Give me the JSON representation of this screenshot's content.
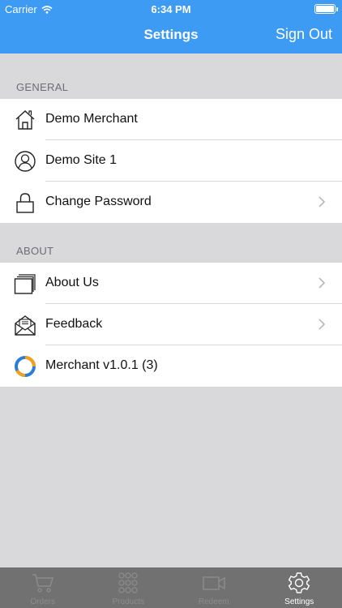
{
  "status_bar": {
    "carrier": "Carrier",
    "time": "6:34 PM"
  },
  "nav": {
    "title": "Settings",
    "right_button": "Sign Out"
  },
  "sections": {
    "general": {
      "label": "GENERAL",
      "items": [
        {
          "label": "Demo Merchant",
          "icon": "home-icon"
        },
        {
          "label": "Demo Site 1",
          "icon": "user-icon"
        },
        {
          "label": "Change Password",
          "icon": "lock-icon"
        }
      ]
    },
    "about": {
      "label": "ABOUT",
      "items": [
        {
          "label": "About Us",
          "icon": "stack-icon"
        },
        {
          "label": "Feedback",
          "icon": "envelope-icon"
        },
        {
          "label": "Merchant v1.0.1 (3)",
          "icon": "app-logo-icon"
        }
      ]
    }
  },
  "tabbar": {
    "tabs": [
      {
        "label": "Orders",
        "icon": "cart-icon"
      },
      {
        "label": "Products",
        "icon": "grid-icon"
      },
      {
        "label": "Redeem",
        "icon": "camera-icon"
      },
      {
        "label": "Settings",
        "icon": "gear-icon",
        "active": true
      }
    ]
  },
  "colors": {
    "accent": "#3d9bf3",
    "background": "#d9d9dc",
    "tabbar": "#717171"
  }
}
